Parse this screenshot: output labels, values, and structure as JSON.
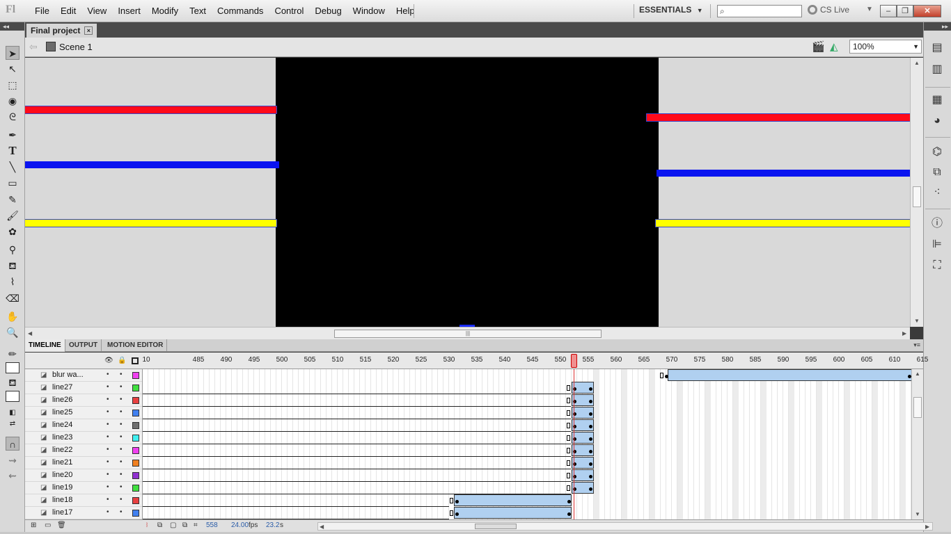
{
  "app": {
    "logo": "Fl"
  },
  "menu": [
    "File",
    "Edit",
    "View",
    "Insert",
    "Modify",
    "Text",
    "Commands",
    "Control",
    "Debug",
    "Window",
    "Help"
  ],
  "workspace": {
    "label": "ESSENTIALS",
    "arrow": "▼"
  },
  "search": {
    "placeholder": ""
  },
  "cslive": {
    "label": "CS Live"
  },
  "window_buttons": {
    "minimize": "–",
    "restore": "❐",
    "close": "✕"
  },
  "document": {
    "tab_label": "Final project",
    "close_glyph": "×",
    "scene_label": "Scene 1",
    "zoom": "100%"
  },
  "stage": {
    "background": "#000000",
    "pasteboard": "#d9d9d9",
    "colors": {
      "red": "#ff0a1a",
      "blue": "#0a14f0",
      "yellow": "#ffff00",
      "outline": "#3344cc"
    }
  },
  "timeline": {
    "tabs": [
      "TIMELINE",
      "OUTPUT",
      "MOTION EDITOR"
    ],
    "ruler": [
      "10",
      "485",
      "490",
      "495",
      "500",
      "505",
      "510",
      "515",
      "520",
      "525",
      "530",
      "535",
      "540",
      "545",
      "550",
      "555",
      "560",
      "565",
      "570",
      "575",
      "580",
      "585",
      "590",
      "595",
      "600",
      "605",
      "610",
      "615"
    ],
    "playhead_frame": 558,
    "layers": [
      {
        "name": "blur wa...",
        "color": "#f040f0"
      },
      {
        "name": "line27",
        "color": "#40e040"
      },
      {
        "name": "line26",
        "color": "#e84040"
      },
      {
        "name": "line25",
        "color": "#4080f0"
      },
      {
        "name": "line24",
        "color": "#707070"
      },
      {
        "name": "line23",
        "color": "#40f0f0"
      },
      {
        "name": "line22",
        "color": "#f040f0"
      },
      {
        "name": "line21",
        "color": "#f08020"
      },
      {
        "name": "line20",
        "color": "#9030d0"
      },
      {
        "name": "line19",
        "color": "#40e040"
      },
      {
        "name": "line18",
        "color": "#e84040"
      },
      {
        "name": "line17",
        "color": "#4080f0"
      }
    ],
    "status": {
      "frame": "558",
      "fps": "24.00",
      "fps_unit": "fps",
      "time": "23.2",
      "time_unit": "s"
    }
  },
  "icons": {
    "tools": [
      "selection-icon",
      "subselection-icon",
      "free-transform-icon",
      "3d-rotation-icon",
      "lasso-icon",
      "pen-icon",
      "text-icon",
      "line-icon",
      "rectangle-icon",
      "pencil-icon",
      "brush-icon",
      "deco-icon",
      "bone-icon",
      "paint-bucket-icon",
      "eyedropper-icon",
      "eraser-icon",
      "hand-icon",
      "zoom-icon"
    ],
    "panels": [
      "properties-icon",
      "library-icon",
      "swatches-icon",
      "color-icon",
      "actions-icon",
      "components-icon",
      "motion-presets-icon",
      "info-icon",
      "align-icon",
      "transform-icon"
    ]
  }
}
